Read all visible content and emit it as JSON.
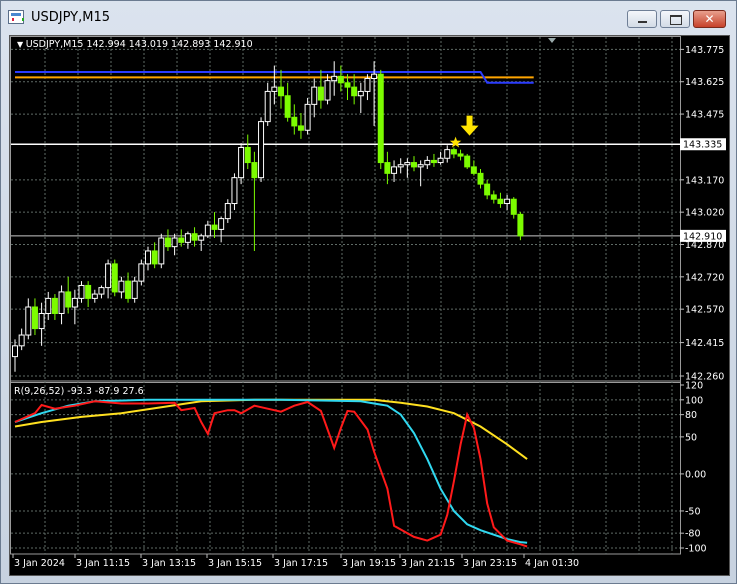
{
  "window": {
    "title": "USDJPY,M15",
    "close_glyph": "✕"
  },
  "main_header": "USDJPY,M15  142.994 143.019 142.893 142.910",
  "indicator_header": "R(9,26,52) -93.3 -87.9 27.6",
  "price_axis": {
    "ticks": [
      "143.775",
      "143.625",
      "143.475",
      "143.170",
      "143.020",
      "142.870",
      "142.720",
      "142.570",
      "142.415",
      "142.260"
    ],
    "badges": [
      "143.335",
      "142.910"
    ]
  },
  "indicator_axis": {
    "ticks": [
      "120",
      "100",
      "80",
      "50",
      "0.00",
      "-50",
      "-80",
      "-100"
    ]
  },
  "time_axis": [
    "3 Jan 2024",
    "3 Jan 11:15",
    "3 Jan 13:15",
    "3 Jan 15:15",
    "3 Jan 17:15",
    "3 Jan 19:15",
    "3 Jan 21:15",
    "3 Jan 23:15",
    "4 Jan 01:30"
  ],
  "colors": {
    "background": "#000000",
    "grid": "#5f6b66",
    "bull_candle": "#ffffff",
    "bear_candle": "#7cfc00",
    "ma_blue": "#2b3cff",
    "ma_orange": "#ffa500",
    "line_red": "#ff1a1a",
    "line_cyan": "#30d8f0",
    "line_yellow": "#ffe020",
    "arrow": "#ffe400"
  },
  "chart_data": {
    "type": "candlestick",
    "symbol": "USDJPY",
    "timeframe": "M15",
    "ylim": [
      142.26,
      143.8
    ],
    "candles": [
      [
        142.35,
        142.43,
        142.28,
        142.4
      ],
      [
        142.4,
        142.48,
        142.38,
        142.45
      ],
      [
        142.45,
        142.62,
        142.43,
        142.58
      ],
      [
        142.58,
        142.62,
        142.45,
        142.48
      ],
      [
        142.48,
        142.6,
        142.4,
        142.55
      ],
      [
        142.55,
        142.65,
        142.52,
        142.62
      ],
      [
        142.62,
        142.64,
        142.52,
        142.55
      ],
      [
        142.55,
        142.68,
        142.5,
        142.65
      ],
      [
        142.65,
        142.72,
        142.55,
        142.58
      ],
      [
        142.58,
        142.66,
        142.5,
        142.62
      ],
      [
        142.62,
        142.7,
        142.6,
        142.68
      ],
      [
        142.68,
        142.7,
        142.58,
        142.62
      ],
      [
        142.62,
        142.66,
        142.6,
        142.64
      ],
      [
        142.64,
        142.68,
        142.62,
        142.67
      ],
      [
        142.67,
        142.8,
        142.62,
        142.78
      ],
      [
        142.78,
        142.8,
        142.63,
        142.65
      ],
      [
        142.65,
        142.72,
        142.62,
        142.7
      ],
      [
        142.7,
        142.74,
        142.6,
        142.62
      ],
      [
        142.62,
        142.72,
        142.6,
        142.7
      ],
      [
        142.7,
        142.8,
        142.68,
        142.78
      ],
      [
        142.78,
        142.86,
        142.75,
        142.84
      ],
      [
        142.84,
        142.88,
        142.76,
        142.78
      ],
      [
        142.78,
        142.92,
        142.76,
        142.9
      ],
      [
        142.9,
        142.94,
        142.84,
        142.86
      ],
      [
        142.86,
        142.92,
        142.82,
        142.9
      ],
      [
        142.9,
        142.94,
        142.86,
        142.88
      ],
      [
        142.88,
        142.93,
        142.85,
        142.92
      ],
      [
        142.92,
        142.95,
        142.86,
        142.89
      ],
      [
        142.89,
        142.92,
        142.84,
        142.91
      ],
      [
        142.91,
        142.98,
        142.9,
        142.96
      ],
      [
        142.96,
        143.02,
        142.9,
        142.94
      ],
      [
        142.94,
        143.0,
        142.88,
        142.99
      ],
      [
        142.99,
        143.08,
        142.97,
        143.06
      ],
      [
        143.06,
        143.2,
        143.03,
        143.18
      ],
      [
        143.18,
        143.34,
        143.15,
        143.32
      ],
      [
        143.32,
        143.38,
        143.22,
        143.25
      ],
      [
        143.25,
        143.3,
        142.84,
        143.18
      ],
      [
        143.18,
        143.46,
        143.16,
        143.44
      ],
      [
        143.44,
        143.62,
        143.42,
        143.58
      ],
      [
        143.58,
        143.7,
        143.52,
        143.6
      ],
      [
        143.6,
        143.68,
        143.5,
        143.56
      ],
      [
        143.56,
        143.62,
        143.44,
        143.46
      ],
      [
        143.46,
        143.52,
        143.38,
        143.42
      ],
      [
        143.42,
        143.48,
        143.36,
        143.4
      ],
      [
        143.4,
        143.55,
        143.38,
        143.52
      ],
      [
        143.52,
        143.64,
        143.46,
        143.6
      ],
      [
        143.6,
        143.68,
        143.5,
        143.54
      ],
      [
        143.54,
        143.66,
        143.52,
        143.63
      ],
      [
        143.63,
        143.72,
        143.56,
        143.65
      ],
      [
        143.65,
        143.7,
        143.58,
        143.62
      ],
      [
        143.62,
        143.66,
        143.54,
        143.6
      ],
      [
        143.6,
        143.66,
        143.52,
        143.56
      ],
      [
        143.56,
        143.62,
        143.48,
        143.58
      ],
      [
        143.58,
        143.66,
        143.54,
        143.64
      ],
      [
        143.64,
        143.72,
        143.42,
        143.66
      ],
      [
        143.66,
        143.68,
        143.22,
        143.25
      ],
      [
        143.25,
        143.3,
        143.15,
        143.2
      ],
      [
        143.2,
        143.26,
        143.16,
        143.23
      ],
      [
        143.23,
        143.27,
        143.2,
        143.24
      ],
      [
        143.24,
        143.27,
        143.18,
        143.25
      ],
      [
        143.25,
        143.28,
        143.21,
        143.23
      ],
      [
        143.23,
        143.26,
        143.14,
        143.24
      ],
      [
        143.24,
        143.28,
        143.22,
        143.26
      ],
      [
        143.26,
        143.29,
        143.23,
        143.25
      ],
      [
        143.25,
        143.3,
        143.24,
        143.27
      ],
      [
        143.27,
        143.33,
        143.25,
        143.31
      ],
      [
        143.31,
        143.32,
        143.27,
        143.29
      ],
      [
        143.29,
        143.31,
        143.26,
        143.28
      ],
      [
        143.28,
        143.29,
        143.22,
        143.23
      ],
      [
        143.23,
        143.26,
        143.19,
        143.2
      ],
      [
        143.2,
        143.22,
        143.13,
        143.15
      ],
      [
        143.15,
        143.17,
        143.08,
        143.1
      ],
      [
        143.1,
        143.12,
        143.06,
        143.08
      ],
      [
        143.08,
        143.11,
        143.04,
        143.06
      ],
      [
        143.06,
        143.1,
        143.03,
        143.08
      ],
      [
        143.08,
        143.09,
        142.99,
        143.01
      ],
      [
        143.01,
        143.02,
        142.89,
        142.91
      ]
    ],
    "ma_blue": [
      [
        0,
        143.67
      ],
      [
        70,
        143.67
      ],
      [
        71,
        143.62
      ],
      [
        78,
        143.62
      ]
    ],
    "ma_orange": [
      [
        0,
        143.645
      ],
      [
        78,
        143.645
      ]
    ],
    "hlines": [
      143.335,
      142.91
    ],
    "signal_index": 67,
    "indicator": {
      "name": "R(9,26,52)",
      "ylim": [
        -100,
        120
      ],
      "red": [
        [
          0,
          70
        ],
        [
          3,
          82
        ],
        [
          4,
          93
        ],
        [
          6,
          88
        ],
        [
          9,
          92
        ],
        [
          12,
          98
        ],
        [
          16,
          95
        ],
        [
          20,
          95
        ],
        [
          24,
          96
        ],
        [
          25,
          86
        ],
        [
          27,
          89
        ],
        [
          28,
          70
        ],
        [
          29,
          54
        ],
        [
          30,
          82
        ],
        [
          32,
          86
        ],
        [
          33,
          86
        ],
        [
          34,
          82
        ],
        [
          36,
          92
        ],
        [
          38,
          88
        ],
        [
          40,
          84
        ],
        [
          42,
          92
        ],
        [
          44,
          97
        ],
        [
          46,
          85
        ],
        [
          47,
          60
        ],
        [
          48,
          35
        ],
        [
          49,
          62
        ],
        [
          50,
          85
        ],
        [
          51,
          84
        ],
        [
          53,
          60
        ],
        [
          54,
          30
        ],
        [
          56,
          -20
        ],
        [
          57,
          -70
        ],
        [
          58,
          -75
        ],
        [
          60,
          -85
        ],
        [
          62,
          -90
        ],
        [
          64,
          -82
        ],
        [
          65,
          -55
        ],
        [
          66,
          -10
        ],
        [
          67,
          40
        ],
        [
          68,
          80
        ],
        [
          69,
          62
        ],
        [
          70,
          20
        ],
        [
          71,
          -40
        ],
        [
          72,
          -72
        ],
        [
          74,
          -90
        ],
        [
          76,
          -95
        ],
        [
          77,
          -98
        ]
      ],
      "cyan": [
        [
          0,
          70
        ],
        [
          4,
          82
        ],
        [
          8,
          92
        ],
        [
          12,
          98
        ],
        [
          20,
          100
        ],
        [
          30,
          100
        ],
        [
          40,
          100
        ],
        [
          52,
          98
        ],
        [
          56,
          92
        ],
        [
          58,
          80
        ],
        [
          60,
          55
        ],
        [
          62,
          20
        ],
        [
          64,
          -20
        ],
        [
          66,
          -50
        ],
        [
          68,
          -68
        ],
        [
          70,
          -76
        ],
        [
          72,
          -82
        ],
        [
          74,
          -88
        ],
        [
          76,
          -92
        ],
        [
          77,
          -93
        ]
      ],
      "yellow": [
        [
          0,
          64
        ],
        [
          4,
          70
        ],
        [
          10,
          77
        ],
        [
          16,
          82
        ],
        [
          22,
          90
        ],
        [
          28,
          98
        ],
        [
          36,
          100
        ],
        [
          48,
          100
        ],
        [
          54,
          100
        ],
        [
          58,
          96
        ],
        [
          62,
          91
        ],
        [
          66,
          82
        ],
        [
          70,
          64
        ],
        [
          74,
          40
        ],
        [
          77,
          20
        ]
      ]
    }
  }
}
